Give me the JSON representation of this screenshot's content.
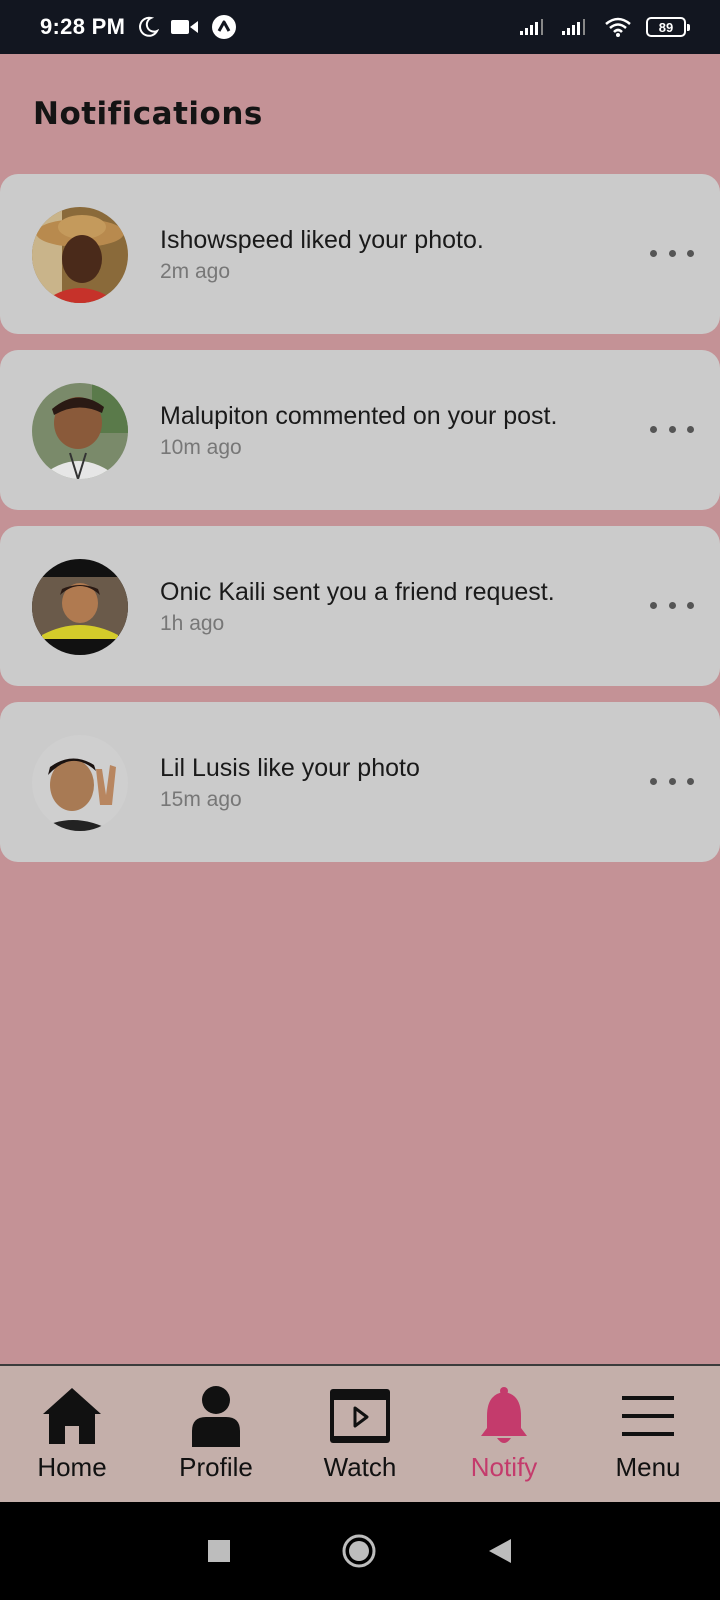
{
  "status_bar": {
    "time": "9:28 PM",
    "battery": "89",
    "icons": [
      "moon-icon",
      "video-camera-icon",
      "app-badge-icon",
      "signal-icon",
      "signal-icon",
      "wifi-icon",
      "battery-icon"
    ]
  },
  "page": {
    "title": "Notifications"
  },
  "notifications": [
    {
      "message": "Ishowspeed liked your photo.",
      "time": "2m ago",
      "avatar": "avatar-ishowspeed"
    },
    {
      "message": "Malupiton commented on your post.",
      "time": "10m ago",
      "avatar": "avatar-malupiton"
    },
    {
      "message": "Onic Kaili sent you a friend request.",
      "time": "1h ago",
      "avatar": "avatar-onic-kaili"
    },
    {
      "message": "Lil Lusis like your photo",
      "time": "15m ago",
      "avatar": "avatar-lil-lusis"
    }
  ],
  "bottom_nav": {
    "items": [
      {
        "label": "Home",
        "icon": "home-icon"
      },
      {
        "label": "Profile",
        "icon": "user-icon"
      },
      {
        "label": "Watch",
        "icon": "video-play-icon"
      },
      {
        "label": "Notify",
        "icon": "bell-icon",
        "active": true
      },
      {
        "label": "Menu",
        "icon": "hamburger-menu-icon"
      }
    ]
  },
  "colors": {
    "background": "#c49296",
    "card": "#cbcbcb",
    "nav_background": "#c4afaa",
    "accent": "#c43b6c",
    "status_bar": "#121620"
  }
}
